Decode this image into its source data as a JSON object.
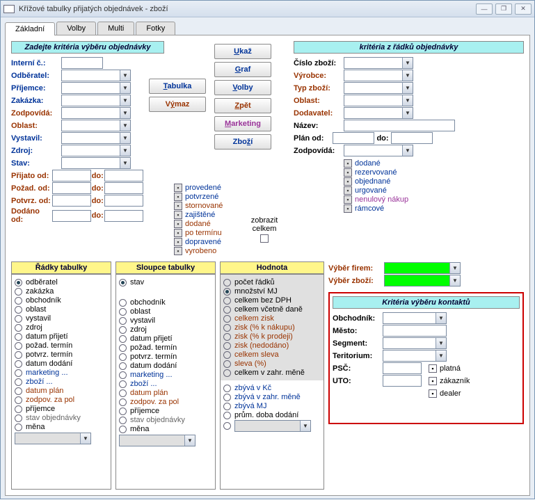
{
  "window": {
    "title": "Křížové tabulky přijatých objednávek - zboží"
  },
  "tabs": {
    "t1": "Základní",
    "t2": "Volby",
    "t3": "Multi",
    "t4": "Fotky"
  },
  "section_left": "Zadejte kritéria výběru objednávky",
  "section_right": "kritéria z řádků objednávky",
  "left_fields": {
    "interni": "Interní č.:",
    "odberatel": "Odběratel:",
    "prijemce": "Příjemce:",
    "zakazka": "Zakázka:",
    "zodpovida": "Zodpovídá:",
    "oblast": "Oblast:",
    "vystavil": "Vystavil:",
    "zdroj": "Zdroj:",
    "stav": "Stav:",
    "prijato_od": "Přijato od:",
    "pozad_od": "Požad. od:",
    "potvrz_od": "Potvrz. od:",
    "dodano_od": "Dodáno od:",
    "do": "do:"
  },
  "right_fields": {
    "cislo": "Číslo zboží:",
    "vyrobce": "Výrobce:",
    "typ": "Typ zboží:",
    "oblast": "Oblast:",
    "dodavatel": "Dodavatel:",
    "nazev": "Název:",
    "plan_od": "Plán od:",
    "do": "do:",
    "zodpovida": "Zodpovídá:"
  },
  "buttons": {
    "tabulka": "Tabulka",
    "vymaz": "Výmaz",
    "ukaz": "Ukaž",
    "graf": "Graf",
    "volby": "Volby",
    "zpet": "Zpět",
    "marketing": "Marketing",
    "zbozi": "Zboží"
  },
  "chk_mid": {
    "provedene": "provedené",
    "potvrzene": "potvrzené",
    "stornovane": "stornované",
    "zajistene": "zajištěné",
    "dodane": "dodané",
    "poterminu": "po termínu",
    "dopravene": "dopravené",
    "vyrobeno": "vyrobeno"
  },
  "zobrazit": {
    "l1": "zobrazit",
    "l2": "celkem"
  },
  "chk_right": {
    "dodane": "dodané",
    "rezervovane": "rezervované",
    "objednane": "objednané",
    "urgovane": "urgované",
    "nenulovy": "nenulový nákup",
    "ramcove": "rámcové"
  },
  "col_titles": {
    "radky": "Řádky tabulky",
    "sloupce": "Sloupce tabulky",
    "hodnota": "Hodnota"
  },
  "radky": [
    "odběratel",
    "zakázka",
    "obchodník",
    "oblast",
    "vystavil",
    "zdroj",
    "datum přijetí",
    "požad. termín",
    "potvrz. termín",
    "datum dodání",
    "marketing ...",
    "zboží ...",
    "datum plán",
    "zodpov. za pol",
    "příjemce",
    "stav objednávky",
    "měna"
  ],
  "sloupce": [
    "stav",
    "",
    "obchodník",
    "oblast",
    "vystavil",
    "zdroj",
    "datum přijetí",
    "požad. termín",
    "potvrz. termín",
    "datum dodání",
    "marketing ...",
    "zboží ...",
    "datum plán",
    "zodpov. za pol",
    "příjemce",
    "stav objednávky",
    "měna"
  ],
  "hodnota": [
    "počet řádků",
    "množství MJ",
    "celkem bez DPH",
    "celkem včetně daně",
    "celkem zisk",
    "zisk (% k nákupu)",
    "zisk (% k prodeji)",
    "zisk (nedodáno)",
    "celkem sleva",
    "sleva (%)",
    "celkem v zahr. měně",
    "zbývá v Kč",
    "zbývá v zahr. měně",
    "zbývá MJ",
    "prům. doba dodání"
  ],
  "vyber": {
    "firem": "Výběr firem:",
    "zbozi": "Výběr zboží:"
  },
  "kontakty": {
    "title": "Kritéria výběru kontaktů",
    "obchodnik": "Obchodník:",
    "mesto": "Město:",
    "segment": "Segment:",
    "teritorium": "Teritorium:",
    "psc": "PSČ:",
    "uto": "UTO:",
    "platna": "platná",
    "zakaznik": "zákazník",
    "dealer": "dealer"
  }
}
